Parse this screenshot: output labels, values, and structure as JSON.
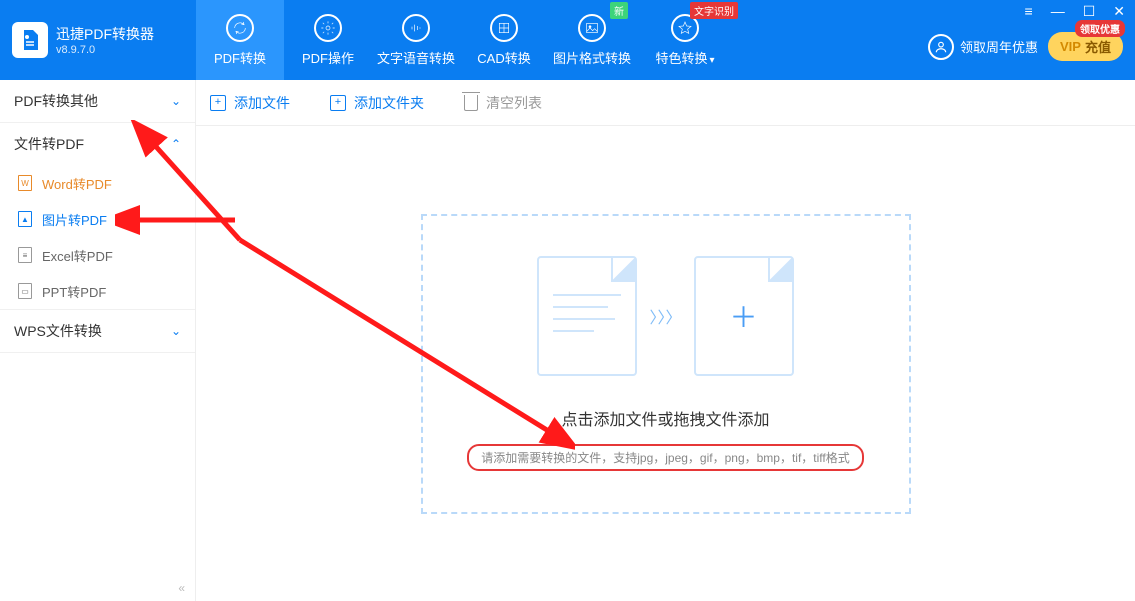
{
  "app": {
    "title": "迅捷PDF转换器",
    "version": "v8.9.7.0"
  },
  "tabs": [
    {
      "label": "PDF转换"
    },
    {
      "label": "PDF操作"
    },
    {
      "label": "文字语音转换"
    },
    {
      "label": "CAD转换"
    },
    {
      "label": "图片格式转换",
      "badge_new": "新"
    },
    {
      "label": "特色转换",
      "badge_text": "文字识别",
      "dropdown": true
    }
  ],
  "header": {
    "anniversary": "领取周年优惠",
    "vip_prefix": "VIP",
    "vip_label": "充值",
    "vip_badge": "领取优惠"
  },
  "sidebar": {
    "groups": [
      {
        "title": "PDF转换其他",
        "open": false
      },
      {
        "title": "文件转PDF",
        "open": true,
        "items": [
          {
            "label": "Word转PDF",
            "hint": "W"
          },
          {
            "label": "图片转PDF",
            "hint": "▲",
            "active": true
          },
          {
            "label": "Excel转PDF",
            "hint": "≡"
          },
          {
            "label": "PPT转PDF",
            "hint": "▭"
          }
        ]
      },
      {
        "title": "WPS文件转换",
        "open": false
      }
    ]
  },
  "toolbar": {
    "add_file": "添加文件",
    "add_folder": "添加文件夹",
    "clear_list": "清空列表"
  },
  "drop": {
    "title": "点击添加文件或拖拽文件添加",
    "hint": "请添加需要转换的文件，支持jpg，jpeg，gif，png，bmp，tif，tiff格式"
  }
}
